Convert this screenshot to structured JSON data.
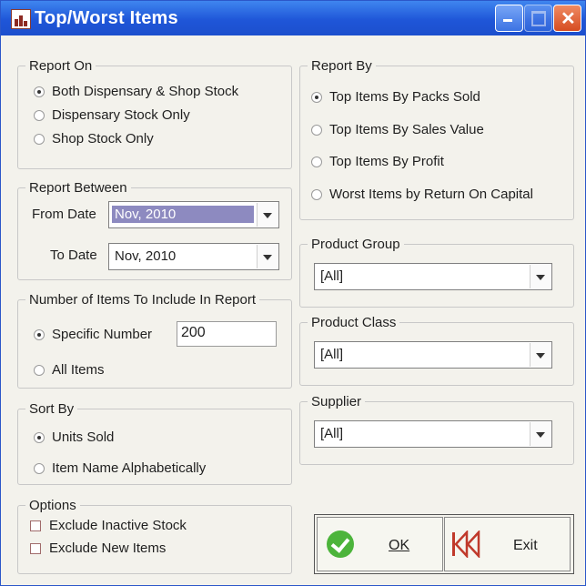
{
  "window": {
    "title": "Top/Worst Items"
  },
  "report_on": {
    "title": "Report On",
    "options": [
      {
        "label": "Both Dispensary & Shop Stock",
        "checked": true
      },
      {
        "label": "Dispensary Stock Only",
        "checked": false
      },
      {
        "label": "Shop Stock Only",
        "checked": false
      }
    ]
  },
  "report_between": {
    "title": "Report Between",
    "from_label": "From Date",
    "from_value": "Nov, 2010",
    "to_label": "To Date",
    "to_value": "Nov, 2010"
  },
  "num_items": {
    "title": "Number of Items To Include In Report",
    "specific_label": "Specific Number",
    "specific_value": "200",
    "all_label": "All Items"
  },
  "sort_by": {
    "title": "Sort By",
    "options": [
      {
        "label": "Units Sold",
        "checked": true
      },
      {
        "label": "Item Name Alphabetically",
        "checked": false
      }
    ]
  },
  "options": {
    "title": "Options",
    "items": [
      {
        "label": "Exclude Inactive Stock",
        "checked": false
      },
      {
        "label": "Exclude New Items",
        "checked": false
      }
    ]
  },
  "report_by": {
    "title": "Report By",
    "options": [
      {
        "label": "Top Items By Packs Sold",
        "checked": true
      },
      {
        "label": "Top Items By Sales Value",
        "checked": false
      },
      {
        "label": "Top Items By Profit",
        "checked": false
      },
      {
        "label": "Worst Items by Return On Capital",
        "checked": false
      }
    ]
  },
  "product_group": {
    "title": "Product Group",
    "value": "[All]"
  },
  "product_class": {
    "title": "Product Class",
    "value": "[All]"
  },
  "supplier": {
    "title": "Supplier",
    "value": "[All]"
  },
  "buttons": {
    "ok": "OK",
    "exit": "Exit"
  },
  "colors": {
    "titlebar": "#1f56d8",
    "ok_icon": "#4cb43b",
    "exit_icon": "#c0392b",
    "selected_date": "#8d8ac0"
  }
}
